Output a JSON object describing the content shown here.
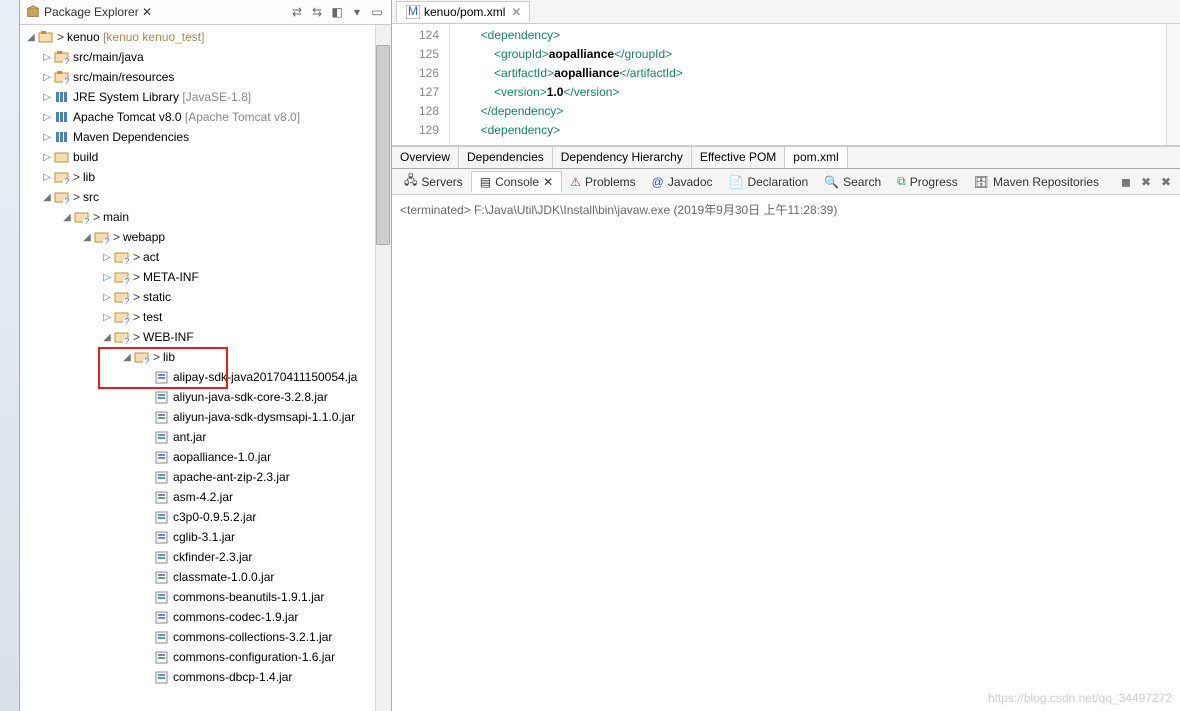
{
  "package_explorer": {
    "title": "Package Explorer",
    "project": {
      "name": "kenuo",
      "decor": "[kenuo kenuo_test]"
    },
    "nodes": {
      "src_main_java": "src/main/java",
      "src_main_resources": "src/main/resources",
      "jre": {
        "label": "JRE System Library",
        "decor": "[JavaSE-1.8]"
      },
      "tomcat": {
        "label": "Apache Tomcat v8.0",
        "decor": "[Apache Tomcat v8.0]"
      },
      "maven_deps": "Maven Dependencies",
      "build": "build",
      "lib_top": "lib",
      "src": "src",
      "main": "main",
      "webapp": "webapp",
      "act": "act",
      "meta_inf": "META-INF",
      "static": "static",
      "test": "test",
      "web_inf": "WEB-INF",
      "lib": "lib"
    },
    "jars": [
      "alipay-sdk-java20170411150054.ja",
      "aliyun-java-sdk-core-3.2.8.jar",
      "aliyun-java-sdk-dysmsapi-1.1.0.jar",
      "ant.jar",
      "aopalliance-1.0.jar",
      "apache-ant-zip-2.3.jar",
      "asm-4.2.jar",
      "c3p0-0.9.5.2.jar",
      "cglib-3.1.jar",
      "ckfinder-2.3.jar",
      "classmate-1.0.0.jar",
      "commons-beanutils-1.9.1.jar",
      "commons-codec-1.9.jar",
      "commons-collections-3.2.1.jar",
      "commons-configuration-1.6.jar",
      "commons-dbcp-1.4.jar"
    ]
  },
  "editor": {
    "tab_title": "kenuo/pom.xml",
    "lines": [
      124,
      125,
      126,
      127,
      128,
      129
    ],
    "pom_tabs": [
      "Overview",
      "Dependencies",
      "Dependency Hierarchy",
      "Effective POM",
      "pom.xml"
    ],
    "code": {
      "l124": {
        "open": "<dependency>"
      },
      "l125": {
        "open": "<groupId>",
        "text": "aopalliance",
        "close": "</groupId>"
      },
      "l126": {
        "open": "<artifactId>",
        "text": "aopalliance",
        "close": "</artifactId>"
      },
      "l127": {
        "open": "<version>",
        "text": "1.0",
        "close": "</version>"
      },
      "l128": {
        "close": "</dependency>"
      },
      "l129": {
        "open": "<dependency>"
      }
    }
  },
  "bottom": {
    "tabs": [
      "Servers",
      "Console",
      "Problems",
      "Javadoc",
      "Declaration",
      "Search",
      "Progress",
      "Maven Repositories"
    ],
    "console_line": "<terminated> F:\\Java\\Util\\JDK\\Install\\bin\\javaw.exe (2019年9月30日 上午11:28:39)"
  },
  "watermark": "https://blog.csdn.net/qq_34497272",
  "gt": ">"
}
